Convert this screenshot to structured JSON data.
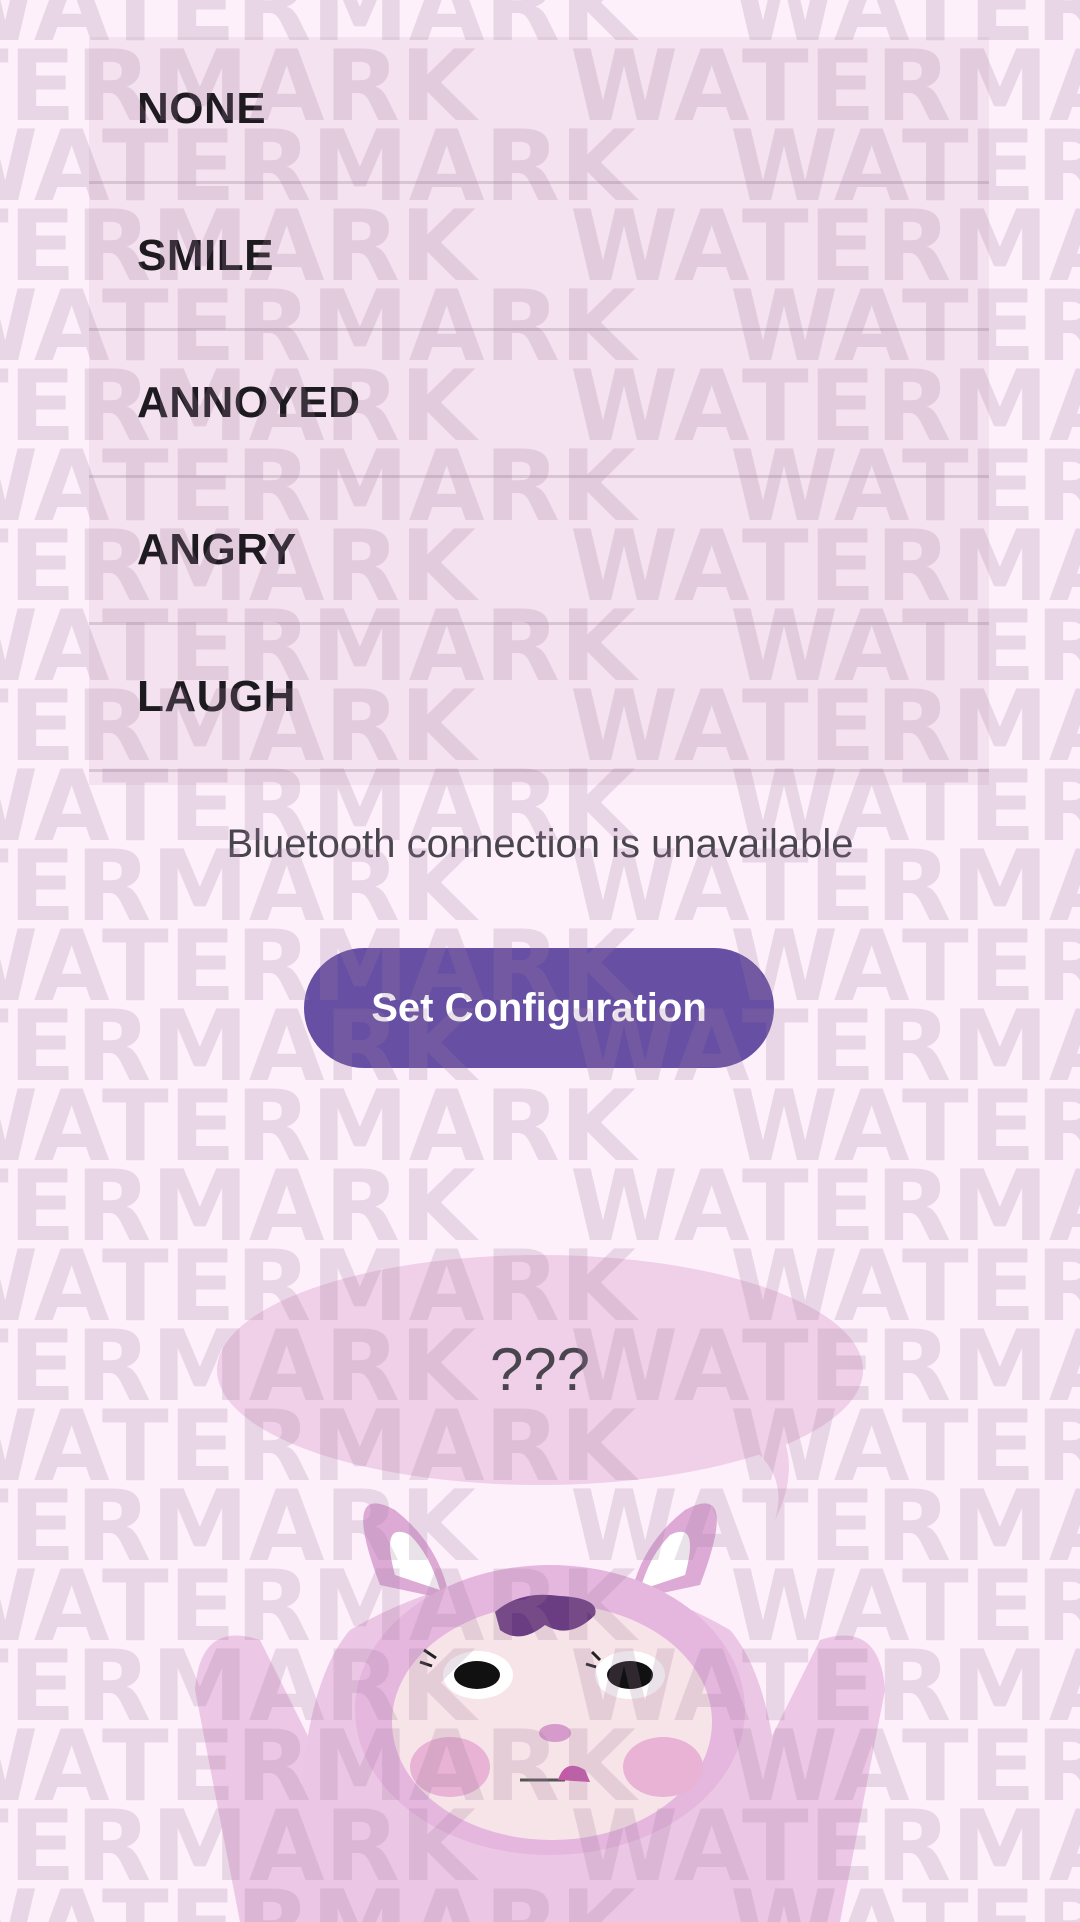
{
  "emotions": [
    {
      "label": "NONE"
    },
    {
      "label": "SMILE"
    },
    {
      "label": "ANNOYED"
    },
    {
      "label": "ANGRY"
    },
    {
      "label": "LAUGH"
    }
  ],
  "status": {
    "text": "Bluetooth connection is unavailable"
  },
  "actions": {
    "set_configuration_label": "Set Configuration"
  },
  "speech_bubble": {
    "text": "???"
  },
  "watermark": {
    "text": "WATERMARK"
  },
  "colors": {
    "background": "#fdf0fb",
    "list_background": "#f4e2f0",
    "list_divider": "#d9c4d5",
    "button": "#6750a4",
    "button_text": "#ffffff",
    "status_text": "#49454f",
    "mascot_pink": "#e9bfe0"
  }
}
